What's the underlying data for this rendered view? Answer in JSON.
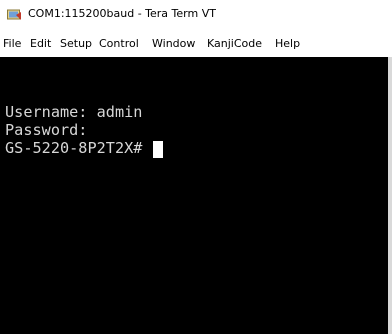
{
  "window": {
    "title": "COM1:115200baud - Tera Term VT",
    "icon": "tera-term-app-icon"
  },
  "menu": {
    "items": [
      "File",
      "Edit",
      "Setup",
      "Control",
      "Window",
      "KanjiCode",
      "Help"
    ]
  },
  "terminal": {
    "lines": [
      "Username: admin",
      "Password:",
      "GS-5220-8P2T2X# "
    ],
    "colors": {
      "background": "#000000",
      "text": "#d7d7d7",
      "cursor": "#ffffff"
    }
  }
}
